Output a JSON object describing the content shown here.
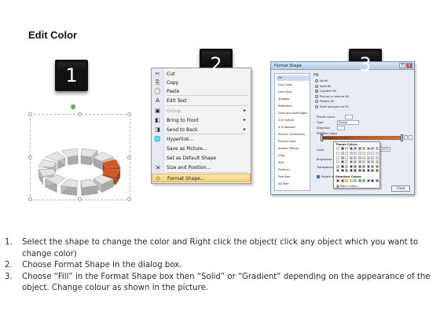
{
  "title": "Edit Color",
  "badges": [
    "1",
    "2",
    "3"
  ],
  "context_menu": {
    "items": [
      {
        "label": "Cut",
        "icon": "scissors-icon",
        "glyph": "✂",
        "disabled": false
      },
      {
        "label": "Copy",
        "icon": "copy-icon",
        "glyph": "⎘",
        "disabled": false
      },
      {
        "label": "Paste",
        "icon": "paste-icon",
        "glyph": "📋",
        "disabled": false
      },
      {
        "label": "Edit Text",
        "icon": "edit-text-icon",
        "glyph": "A",
        "disabled": false
      },
      {
        "label": "Group",
        "icon": "group-icon",
        "glyph": "▣",
        "disabled": true,
        "submenu": true
      },
      {
        "label": "Bring to Front",
        "icon": "bring-front-icon",
        "glyph": "◧",
        "disabled": false,
        "submenu": true
      },
      {
        "label": "Send to Back",
        "icon": "send-back-icon",
        "glyph": "◨",
        "disabled": false,
        "submenu": true
      },
      {
        "label": "Hyperlink...",
        "icon": "hyperlink-icon",
        "glyph": "🌐",
        "disabled": false
      },
      {
        "label": "Save as Picture...",
        "icon": "save-picture-icon",
        "glyph": "",
        "disabled": false
      },
      {
        "label": "Set as Default Shape",
        "icon": "default-shape-icon",
        "glyph": "",
        "disabled": false
      },
      {
        "label": "Size and Position...",
        "icon": "size-position-icon",
        "glyph": "⇲",
        "disabled": false
      },
      {
        "label": "Format Shape...",
        "icon": "format-shape-icon",
        "glyph": "◇",
        "disabled": false,
        "selected": true
      }
    ]
  },
  "dialog": {
    "title": "Format Shape",
    "help": "?",
    "close": "X",
    "categories": [
      "Fill",
      "Line Color",
      "Line Style",
      "Shadow",
      "Reflection",
      "Glow and Soft Edges",
      "3-D Format",
      "3-D Rotation",
      "Picture Corrections",
      "Picture Color",
      "Artistic Effects",
      "Crop",
      "Size",
      "Position",
      "Text Box",
      "Alt Text"
    ],
    "fill_heading": "Fill",
    "fill_options": [
      "No fill",
      "Solid fill",
      "Gradient fill",
      "Picture or texture fill",
      "Pattern fill",
      "Slide background fill"
    ],
    "selected_fill": "Gradient fill",
    "labels": {
      "preset": "Preset colors:",
      "type": "Type:",
      "type_value": "Radial",
      "direction": "Direction:",
      "angle": "Angle:",
      "gradient_stops": "Gradient stops",
      "color": "Color",
      "position": "Position:",
      "position_value": "100%",
      "brightness": "Brightness:",
      "transparency": "Transparency:",
      "rotate": "Rotate with shape",
      "close_button": "Close"
    },
    "palette": {
      "theme_colors": "Theme Colors",
      "standard_colors": "Standard Colors",
      "more_colors": "More Colors..."
    },
    "colors": {
      "gradient_dark": "#7a3a10",
      "gradient_accent": "#c4541b",
      "theme_row": [
        "#ffffff",
        "#000000",
        "#eeece1",
        "#1f497d",
        "#4f81bd",
        "#c0504d",
        "#9bbb59",
        "#8064a2",
        "#4bacc6",
        "#f79646"
      ],
      "standard_row": [
        "#c00000",
        "#ff0000",
        "#ffc000",
        "#ffff00",
        "#92d050",
        "#00b050",
        "#00b0f0",
        "#0070c0",
        "#002060",
        "#7030a0"
      ]
    }
  },
  "ring": {
    "segment_count": 12,
    "highlight_color": "#d9541e"
  },
  "steps": [
    {
      "n": "1.",
      "text": "Select the shape to change the color and Right click the object( click any object which you want to change color)"
    },
    {
      "n": "2.",
      "text": "Choose Format Shape in the dialog box."
    },
    {
      "n": "3.",
      "text": "Choose “Fill” in the Format Shape box then “Solid” or “Gradient” depending on the appearance of the object. Change colour as shown in the picture."
    }
  ]
}
